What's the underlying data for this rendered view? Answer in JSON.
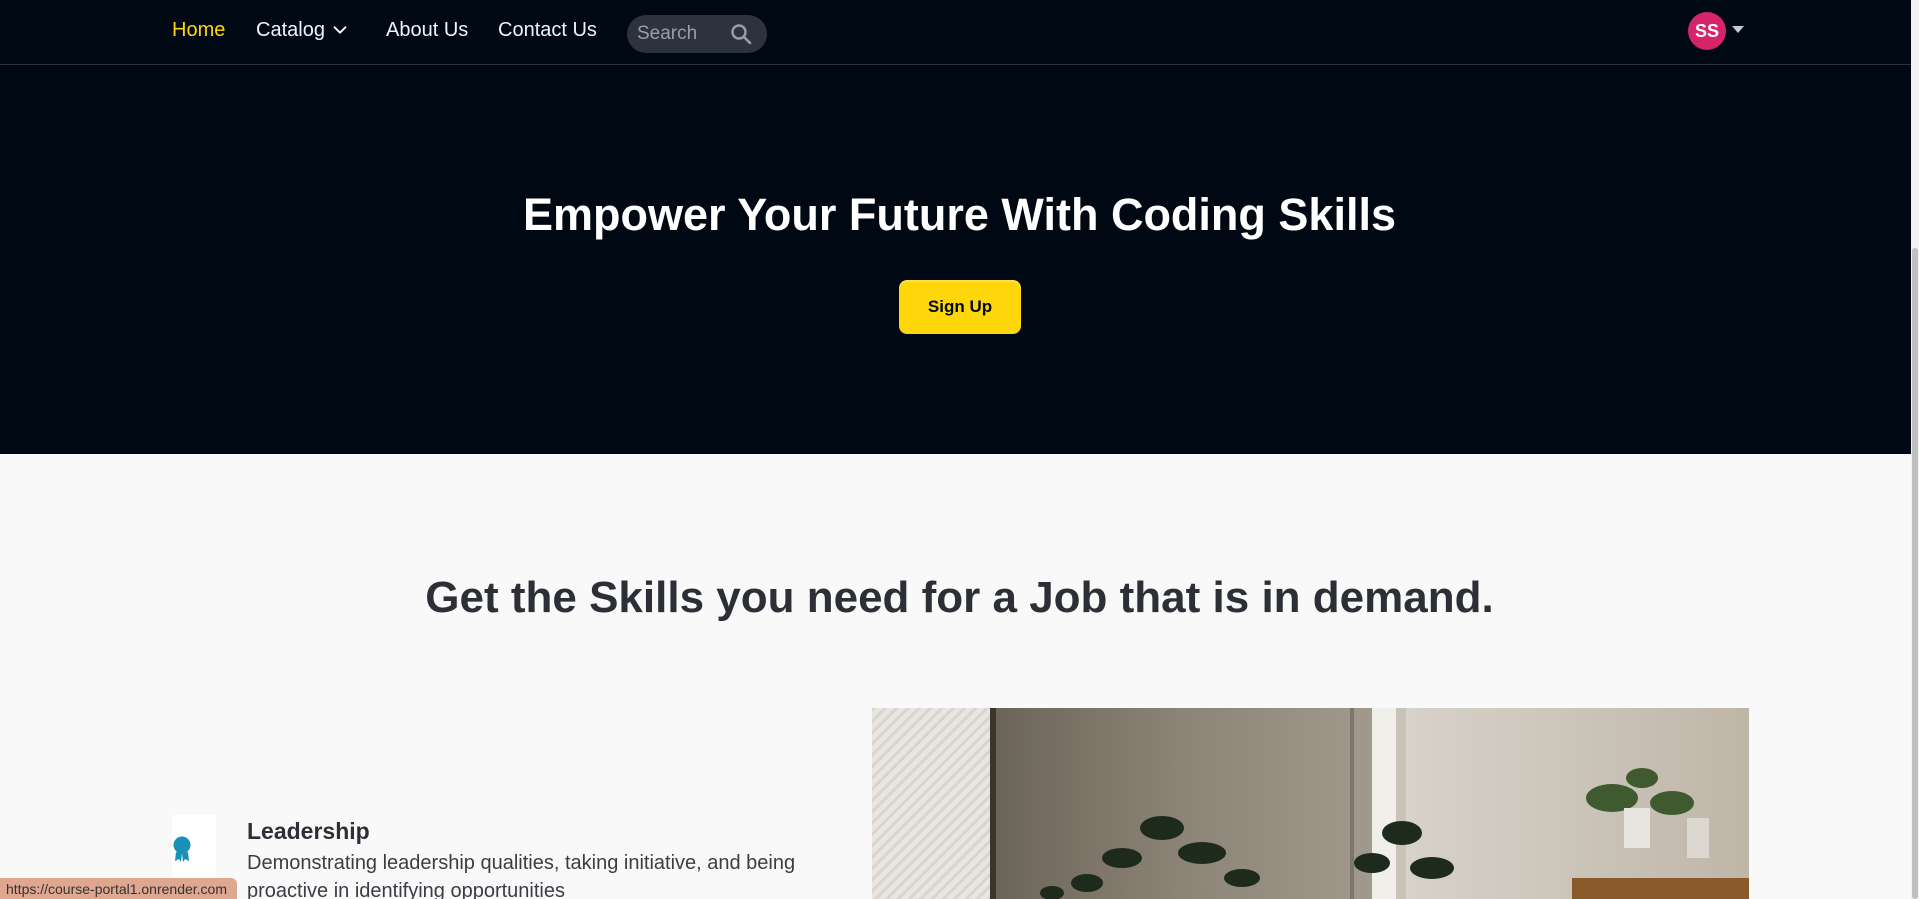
{
  "navbar": {
    "links": {
      "home": "Home",
      "catalog": "Catalog",
      "about": "About Us",
      "contact": "Contact Us"
    },
    "search": {
      "placeholder": "Search"
    },
    "avatar_initials": "SS"
  },
  "hero": {
    "title": "Empower Your Future With Coding Skills",
    "signup_label": "Sign Up"
  },
  "skills": {
    "heading": "Get the Skills you need for a Job that is in demand.",
    "feature": {
      "title": "Leadership",
      "description": "Demonstrating leadership qualities, taking initiative, and being proactive in identifying opportunities"
    }
  },
  "status_url": "https://course-portal1.onrender.com",
  "colors": {
    "navbar_bg": "#000814",
    "accent": "#ffd60a",
    "avatar_bg": "#d6246a",
    "section_bg": "#f9f9f9",
    "icon_teal": "#1a8fb8"
  },
  "icons": {
    "catalog_chevron": "chevron-down-icon",
    "search": "search-icon",
    "avatar_caret": "caret-down-icon",
    "feature": "award-icon"
  }
}
